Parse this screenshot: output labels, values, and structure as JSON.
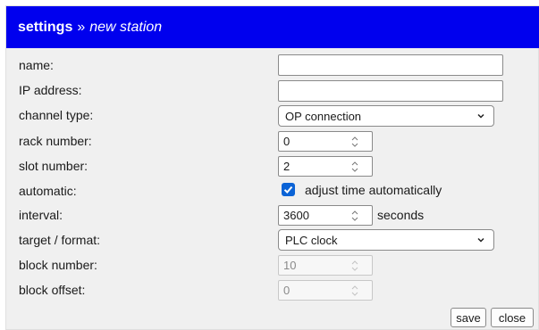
{
  "dialog": {
    "title": "settings",
    "separator": "»",
    "subtitle": "new station"
  },
  "fields": {
    "name": {
      "label": "name:",
      "value": ""
    },
    "ip_address": {
      "label": "IP address:",
      "value": ""
    },
    "channel_type": {
      "label": "channel type:",
      "value": "OP connection"
    },
    "rack_number": {
      "label": "rack number:",
      "value": "0"
    },
    "slot_number": {
      "label": "slot number:",
      "value": "2"
    },
    "automatic": {
      "label": "automatic:",
      "checkbox_label": "adjust time automatically",
      "checked": true
    },
    "interval": {
      "label": "interval:",
      "value": "3600",
      "unit": "seconds"
    },
    "target_format": {
      "label": "target / format:",
      "value": "PLC clock"
    },
    "block_number": {
      "label": "block number:",
      "value": "10",
      "disabled": true
    },
    "block_offset": {
      "label": "block offset:",
      "value": "0",
      "disabled": true
    }
  },
  "buttons": {
    "save": "save",
    "close": "close"
  },
  "colors": {
    "titlebar": "#0000ee",
    "checkbox": "#0b63d6",
    "panel": "#f0f0f0"
  },
  "icons": {
    "dropdown": "chevron-down-icon",
    "spinner": "spin-arrows-icon",
    "check": "checkmark-icon"
  }
}
